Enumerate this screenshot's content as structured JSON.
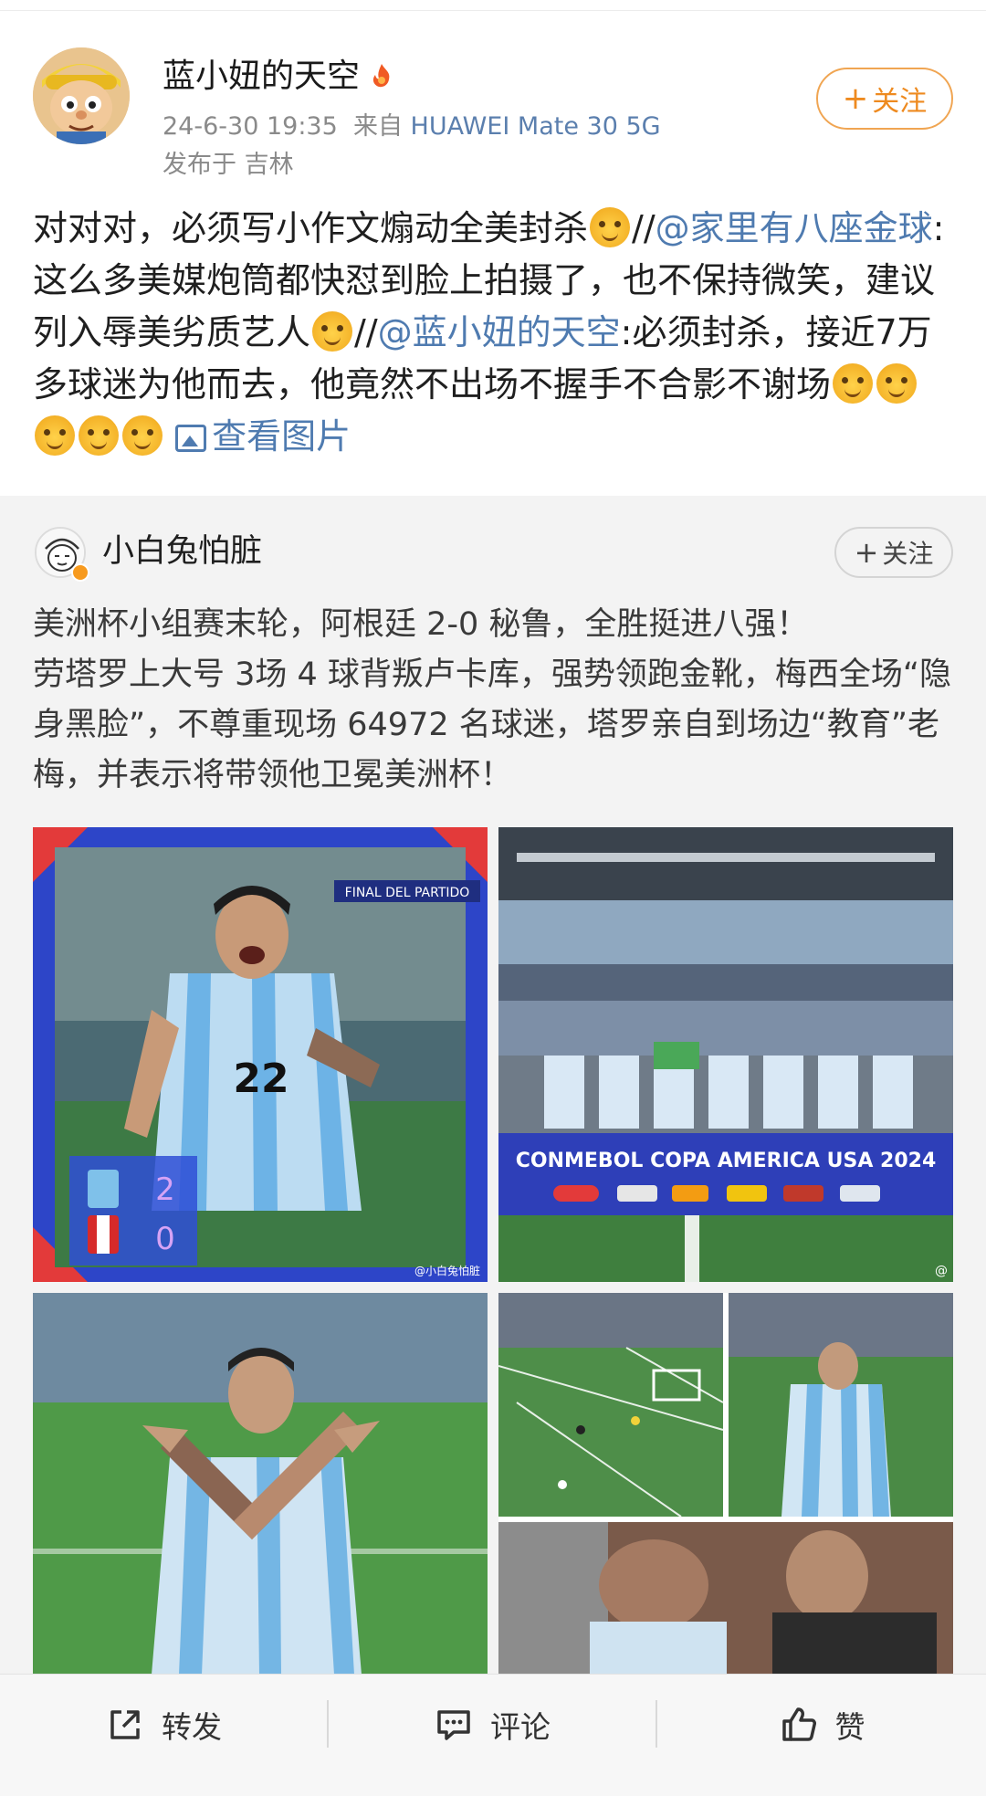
{
  "author": {
    "name": "蓝小妞的天空",
    "timestamp": "24-6-30 19:35",
    "source_prefix": "来自",
    "device": "HUAWEI Mate 30 5G",
    "location": "发布于 吉林",
    "follow_label": "关注"
  },
  "post": {
    "seg1": "对对对，必须写小作文煽动全美封杀",
    "sep1": "//",
    "mention1": "@家里有八座金球",
    "seg2": ":这么多美媒炮筒都快怼到脸上拍摄了，也不保持微笑，建议列入辱美劣质艺人",
    "sep2": "//",
    "mention2": "@蓝小妞的天空",
    "seg3": ":必须封杀，接近7万多球迷为他而去，他竟然不出场不握手不合影不谢场",
    "view_images": "查看图片"
  },
  "retweet": {
    "name": "小白兔怕脏",
    "follow_label": "关注",
    "line1": "美洲杯小组赛末轮，阿根廷 2-0 秘鲁，全胜挺进八强！",
    "line2": "劳塔罗上大号 3场 4 球背叛卢卡库，强势领跑金靴，梅西全场“隐身黑脸”，不尊重现场 64972 名球迷，塔罗亲自到场边“教育”老梅，并表示将带领他卫冕美洲杯！",
    "images": {
      "img1_banner": "FINAL DEL PARTIDO",
      "img1_score_home": "2",
      "img1_score_away": "0",
      "img1_watermark": "@小白兔怕脏",
      "img2_banner": "CONMEBOL COPA AMERICA USA 2024",
      "img2_watermark": "@",
      "jersey_number": "22"
    }
  },
  "actions": {
    "repost": "转发",
    "comment": "评论",
    "like": "赞"
  }
}
